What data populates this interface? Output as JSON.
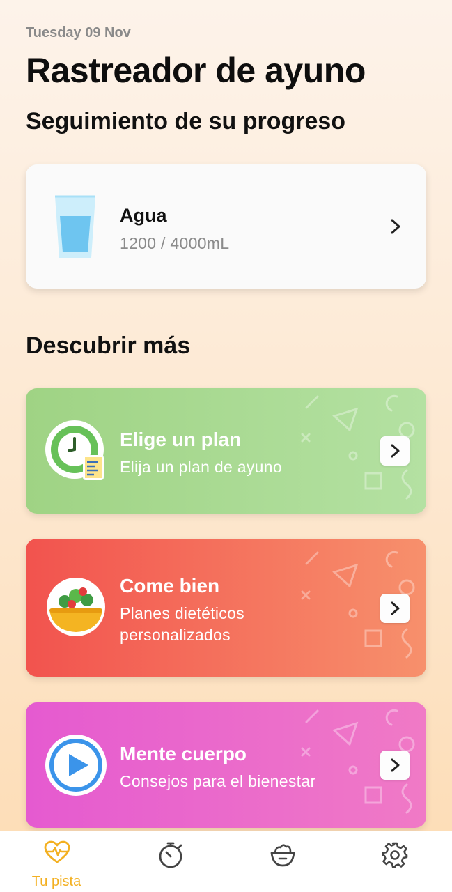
{
  "header": {
    "date": "Tuesday 09 Nov",
    "title": "Rastreador de ayuno",
    "subtitle": "Seguimiento de su progreso"
  },
  "water": {
    "title": "Agua",
    "current_ml": 1200,
    "goal_ml": 4000,
    "value_text": "1200 / 4000mL"
  },
  "discover": {
    "heading": "Descubrir más",
    "cards": [
      {
        "title": "Elige un plan",
        "subtitle": "Elija un plan de ayuno",
        "icon": "clock-plan-icon",
        "color": "#9fd384"
      },
      {
        "title": "Come bien",
        "subtitle": "Planes dietéticos personalizados",
        "icon": "salad-bowl-icon",
        "color": "#f2534e"
      },
      {
        "title": "Mente cuerpo",
        "subtitle": "Consejos para el bienestar",
        "icon": "play-icon",
        "color": "#e55ad0"
      }
    ]
  },
  "tabbar": {
    "active_color": "#f3b021",
    "tabs": [
      {
        "label": "Tu pista",
        "icon": "heart-pulse-icon",
        "active": true
      },
      {
        "label": "",
        "icon": "stopwatch-icon",
        "active": false
      },
      {
        "label": "",
        "icon": "food-bowl-icon",
        "active": false
      },
      {
        "label": "",
        "icon": "gear-icon",
        "active": false
      }
    ]
  }
}
